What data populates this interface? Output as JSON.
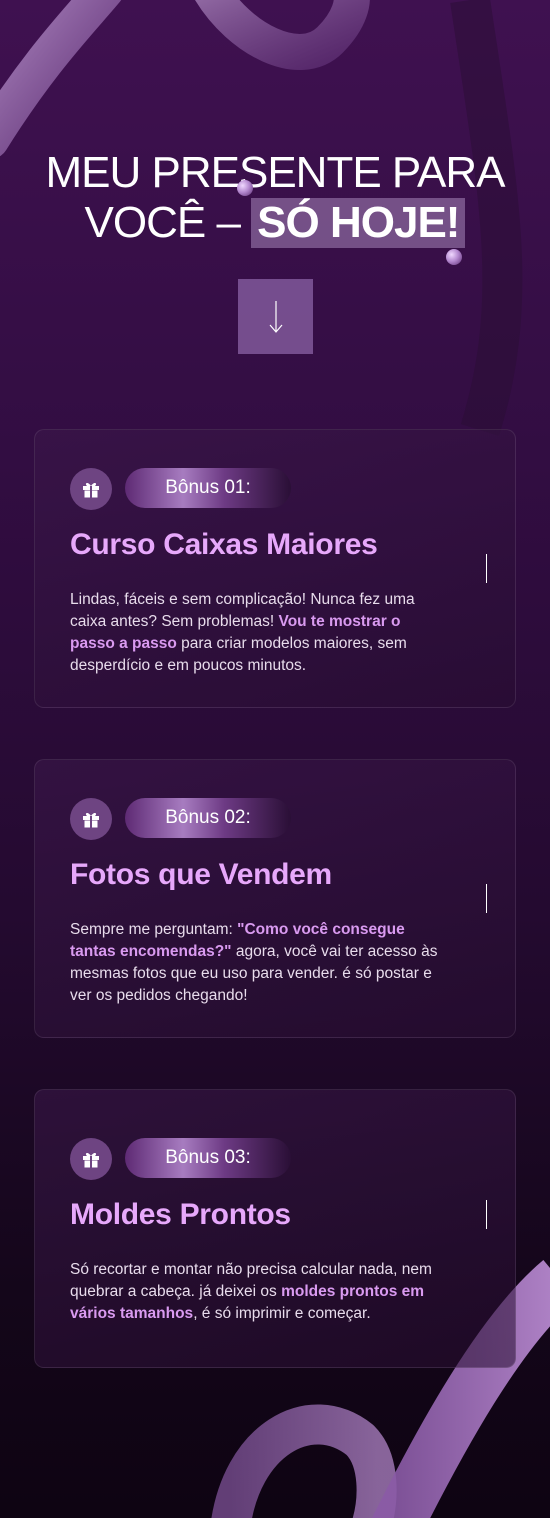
{
  "hero": {
    "title_line1": "MEU PRESENTE PARA",
    "title_line2_prefix": "VOCÊ – ",
    "title_highlight": "SÓ HOJE!"
  },
  "arrow": {
    "icon": "arrow-down-icon"
  },
  "bonuses": [
    {
      "label": "Bônus 01:",
      "title": "Curso Caixas Maiores",
      "desc": [
        {
          "t": "Lindas, fáceis e sem complicação! Nunca fez uma caixa antes? Sem problemas! ",
          "em": false
        },
        {
          "t": "Vou te mostrar o passo a passo",
          "em": true
        },
        {
          "t": " para criar modelos maiores, sem desperdício e em poucos minutos.",
          "em": false
        }
      ]
    },
    {
      "label": "Bônus 02:",
      "title": "Fotos que Vendem",
      "desc": [
        {
          "t": "Sempre me perguntam: ",
          "em": false
        },
        {
          "t": "\"Como você consegue tantas encomendas?\"",
          "em": true
        },
        {
          "t": " agora, você vai ter acesso às mesmas fotos que eu uso para vender. é só postar e ver os pedidos chegando!",
          "em": false
        }
      ]
    },
    {
      "label": "Bônus 03:",
      "title": "Moldes Prontos",
      "desc": [
        {
          "t": "Só recortar e montar não precisa calcular nada, nem quebrar a cabeça. já deixei os ",
          "em": false
        },
        {
          "t": "moldes prontos em vários tamanhos",
          "em": true
        },
        {
          "t": ", é só imprimir e começar.",
          "em": false
        }
      ]
    }
  ],
  "colors": {
    "accent": "#e7a8fb",
    "accent_text": "#d99af0",
    "background_top": "#3f1150",
    "background_bottom": "#0e0412"
  }
}
